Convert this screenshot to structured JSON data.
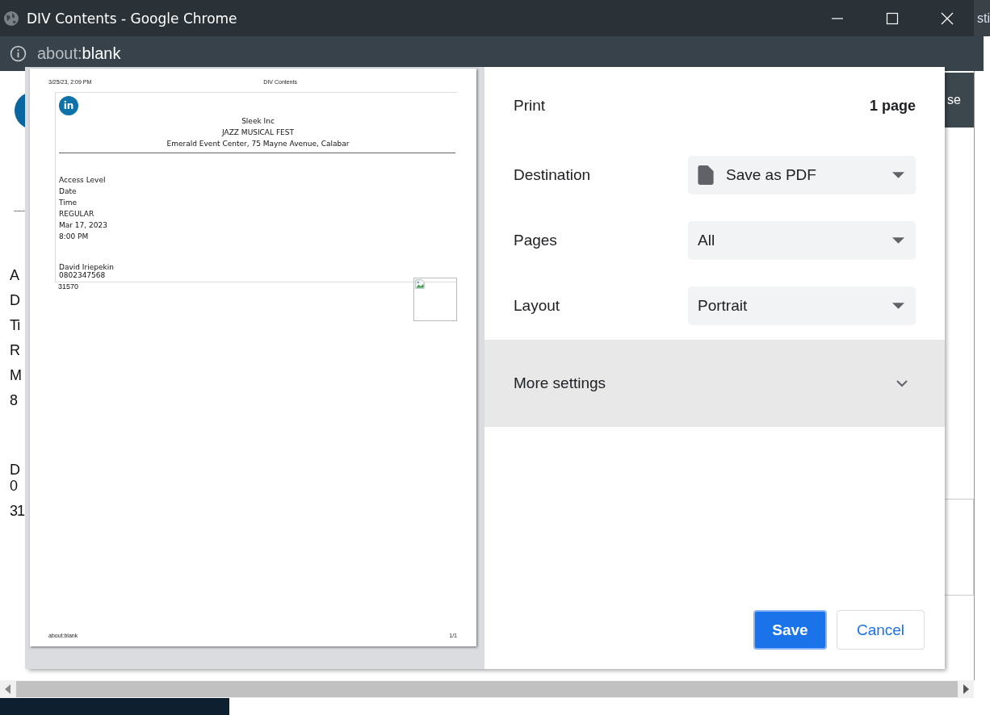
{
  "window": {
    "title": "DIV Contents - Google Chrome"
  },
  "address_bar": {
    "scheme": "about:",
    "path": "blank"
  },
  "background_page": {
    "behind_window_title": "sti",
    "right_fragment": "se",
    "left_groups": [
      [
        "A",
        "D",
        "Ti",
        "R",
        "M",
        "8"
      ],
      [
        "D",
        "0"
      ],
      [
        "31"
      ]
    ]
  },
  "print_preview": {
    "header_date": "3/25/23, 2:09 PM",
    "header_title": "DIV Contents",
    "ticket": {
      "logo_text": "in",
      "organizer": "Sleek Inc",
      "event": "JAZZ MUSICAL FEST",
      "venue": "Emerald Event Center, 75 Mayne Avenue, Calabar",
      "fields": [
        "Access Level",
        "Date",
        "Time",
        "REGULAR",
        "Mar 17, 2023",
        "8:00 PM"
      ],
      "holder": "David Iriepekin",
      "phone": "0802347568",
      "code": "31570"
    },
    "footer_url": "about:blank",
    "footer_pages": "1/1"
  },
  "print_settings": {
    "title": "Print",
    "page_count": "1 page",
    "options": [
      {
        "label": "Destination",
        "value": "Save as PDF",
        "kind": "destination"
      },
      {
        "label": "Pages",
        "value": "All",
        "kind": "plain"
      },
      {
        "label": "Layout",
        "value": "Portrait",
        "kind": "plain"
      }
    ],
    "more_settings": {
      "label": "More settings",
      "expanded": false
    },
    "buttons": [
      {
        "label": "Save",
        "kind": "primary"
      },
      {
        "label": "Cancel",
        "kind": "secondary"
      }
    ]
  }
}
